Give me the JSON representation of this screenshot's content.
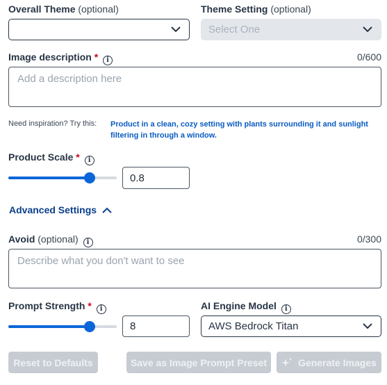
{
  "overall_theme": {
    "label": "Overall Theme",
    "optional": "(optional)",
    "value": ""
  },
  "theme_setting": {
    "label": "Theme Setting",
    "optional": "(optional)",
    "placeholder": "Select One"
  },
  "image_description": {
    "label": "Image description",
    "required": "*",
    "counter": "0/600",
    "placeholder": "Add a description here"
  },
  "inspiration": {
    "label": "Need inspiration? Try this:",
    "suggestion": "Product in a clean, cozy setting with plants surrounding it and sunlight filtering in through a window."
  },
  "product_scale": {
    "label": "Product Scale",
    "required": "*",
    "value": "0.8",
    "slider_fraction": 0.75
  },
  "advanced": {
    "label": "Advanced Settings",
    "expanded": true
  },
  "avoid": {
    "label": "Avoid",
    "optional": "(optional)",
    "counter": "0/300",
    "placeholder": "Describe what you don't want to see"
  },
  "prompt_strength": {
    "label": "Prompt Strength",
    "required": "*",
    "value": "8",
    "slider_fraction": 0.75
  },
  "ai_engine": {
    "label": "AI Engine Model",
    "value": "AWS Bedrock Titan"
  },
  "buttons": {
    "reset": "Reset to Defaults",
    "save_preset": "Save as Image Prompt Preset",
    "generate": "Generate Images"
  },
  "colors": {
    "accent": "#0a66d8",
    "required": "#d0021b",
    "disabled": "#c7ccd3",
    "link": "#0a3f8c"
  }
}
